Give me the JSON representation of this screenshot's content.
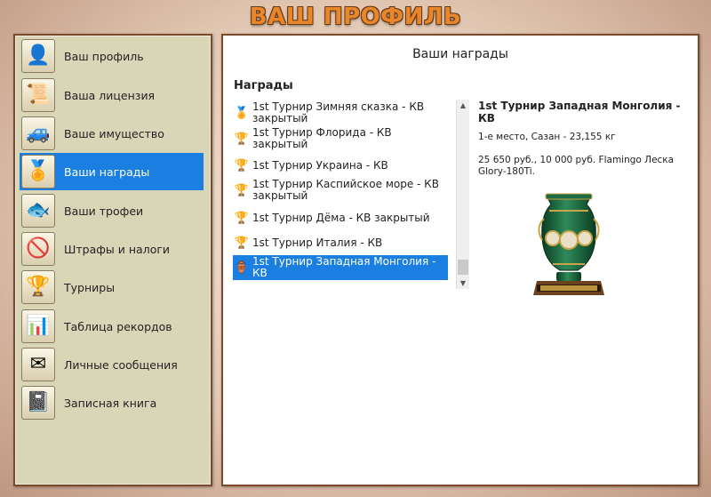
{
  "window": {
    "title": "ВАШ ПРОФИЛЬ"
  },
  "sidebar": {
    "items": [
      {
        "label": "Ваш профиль",
        "icon": "person-icon",
        "glyph": "👤"
      },
      {
        "label": "Ваша лицензия",
        "icon": "license-icon",
        "glyph": "📜"
      },
      {
        "label": "Ваше имущество",
        "icon": "property-icon",
        "glyph": "🚙"
      },
      {
        "label": "Ваши награды",
        "icon": "medals-icon",
        "glyph": "🏅",
        "active": true
      },
      {
        "label": "Ваши трофеи",
        "icon": "fish-trophy-icon",
        "glyph": "🐟"
      },
      {
        "label": "Штрафы и налоги",
        "icon": "fines-icon",
        "glyph": "🚫"
      },
      {
        "label": "Турниры",
        "icon": "cup-icon",
        "glyph": "🏆"
      },
      {
        "label": "Таблица рекордов",
        "icon": "bar-chart-icon",
        "glyph": "📊"
      },
      {
        "label": "Личные сообщения",
        "icon": "messages-icon",
        "glyph": "✉"
      },
      {
        "label": "Записная книга",
        "icon": "notebook-icon",
        "glyph": "📓"
      }
    ]
  },
  "main": {
    "title": "Ваши награды",
    "awards_heading": "Награды",
    "awards": [
      {
        "label": "1st Турнир Зимняя сказка - КВ закрытый",
        "glyph": "🏅"
      },
      {
        "label": "1st Турнир Флорида - КВ закрытый",
        "glyph": "🏆"
      },
      {
        "label": "1st Турнир Украина - КВ",
        "glyph": "🏆"
      },
      {
        "label": "1st Турнир Каспийское море - КВ закрытый",
        "glyph": "🏆"
      },
      {
        "label": "1st Турнир Дёма - КВ закрытый",
        "glyph": "🏆"
      },
      {
        "label": "1st Турнир Италия - КВ",
        "glyph": "🏆"
      },
      {
        "label": "1st Турнир Западная Монголия - КВ",
        "glyph": "🏺",
        "selected": true
      }
    ],
    "detail": {
      "title": "1st Турнир Западная Монголия - КВ",
      "place": "1-е место, Сазан - 23,155 кг",
      "prize": "25 650 руб., 10 000 руб. Flamingo Леска Glory-180Ti."
    }
  },
  "colors": {
    "accent": "#1a7fe0",
    "sidebar_bg": "#d9d5b7",
    "border": "#7b4a2c",
    "title": "#e8862c"
  }
}
